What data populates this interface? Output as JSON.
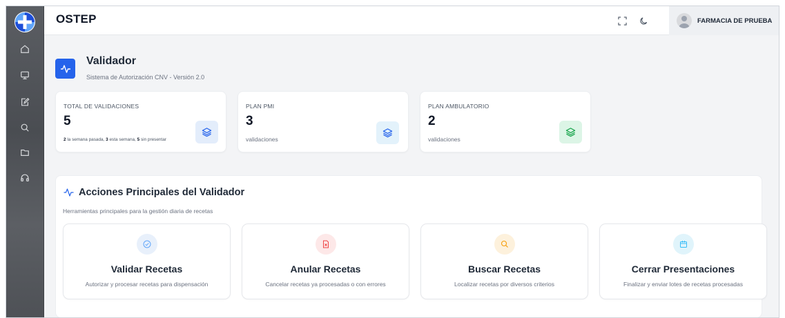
{
  "header": {
    "brand": "OSTEP",
    "user_name": "FARMACIA DE PRUEBA"
  },
  "sidebar": {
    "items": [
      {
        "icon": "home-icon"
      },
      {
        "icon": "monitor-icon"
      },
      {
        "icon": "edit-document-icon"
      },
      {
        "icon": "search-icon"
      },
      {
        "icon": "folder-icon"
      },
      {
        "icon": "headset-icon"
      }
    ]
  },
  "page": {
    "title": "Validador",
    "subtitle": "Sistema de Autorización CNV - Versión 2.0"
  },
  "stats": [
    {
      "label": "TOTAL DE VALIDACIONES",
      "value": "5",
      "note_parts": [
        "2",
        " la semana pasada, ",
        "3",
        " esta semana, ",
        "5",
        " sin presentar"
      ],
      "icon_color": "#2563eb",
      "icon_bg": "#e3edfb"
    },
    {
      "label": "PLAN PMI",
      "value": "3",
      "note": "validaciones",
      "icon_color": "#2563eb",
      "icon_bg": "#e3f2fb"
    },
    {
      "label": "PLAN AMBULATORIO",
      "value": "2",
      "note": "validaciones",
      "icon_color": "#16a34a",
      "icon_bg": "#dcf5e6"
    }
  ],
  "actions": {
    "title": "Acciones Principales del Validador",
    "subtitle": "Herramientas principales para la gestión diaria de recetas",
    "items": [
      {
        "title": "Validar Recetas",
        "desc": "Autorizar y procesar recetas para dispensación",
        "icon": "check-circle-icon",
        "color": "#60a5fa",
        "bg": "#e8f0fb"
      },
      {
        "title": "Anular Recetas",
        "desc": "Cancelar recetas ya procesadas o con errores",
        "icon": "cancel-document-icon",
        "color": "#ef4444",
        "bg": "#fde8e8"
      },
      {
        "title": "Buscar Recetas",
        "desc": "Localizar recetas por diversos criterios",
        "icon": "search-icon",
        "color": "#f59e0b",
        "bg": "#fdf1dc"
      },
      {
        "title": "Cerrar Presentaciones",
        "desc": "Finalizar y enviar lotes de recetas procesadas",
        "icon": "package-icon",
        "color": "#38bdf8",
        "bg": "#e0f4fb"
      }
    ]
  },
  "colors": {
    "accent": "#2563eb",
    "sidebar": "#54575c"
  }
}
